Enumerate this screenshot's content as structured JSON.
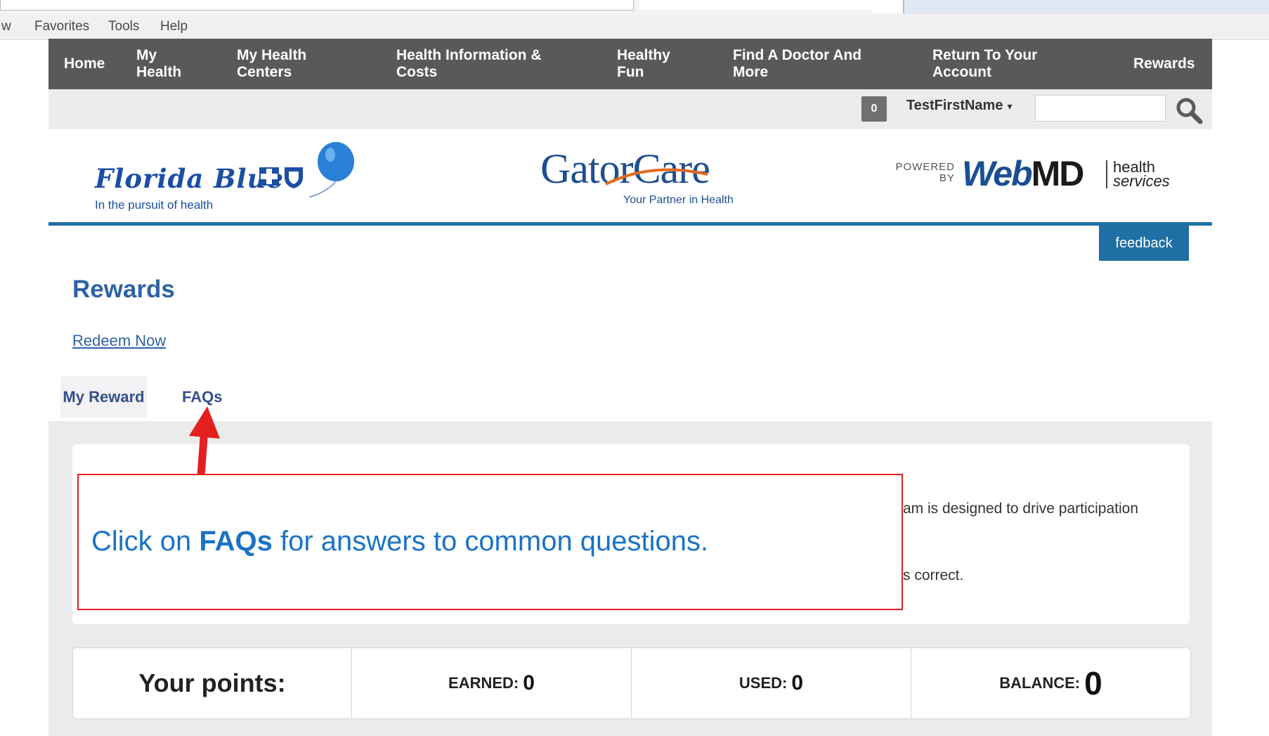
{
  "browser": {
    "menu": [
      "w",
      "Favorites",
      "Tools",
      "Help"
    ]
  },
  "nav": {
    "items": [
      "Home",
      "My Health",
      "My Health Centers",
      "Health Information & Costs",
      "Healthy Fun",
      "Find A Doctor And More",
      "Return To Your Account",
      "Rewards"
    ]
  },
  "utility": {
    "badge_count": "0",
    "username": "TestFirstName",
    "caret": "▾",
    "search_placeholder": ""
  },
  "logos": {
    "florida_blue": "Florida Blue",
    "florida_blue_tagline": "In the pursuit of health",
    "gatorcare": "GatorCare",
    "gatorcare_tagline": "Your Partner in Health",
    "powered_by": "POWERED BY",
    "webmd_web": "Web",
    "webmd_md": "MD",
    "health": "health",
    "services": "services"
  },
  "feedback_label": "feedback",
  "page": {
    "title": "Rewards",
    "redeem_link": "Redeem Now",
    "tabs": [
      "My Reward",
      "FAQs"
    ]
  },
  "info": {
    "line1_fragment": "am is designed to drive participation",
    "line2_fragment": "s correct."
  },
  "points": {
    "heading": "Your points:",
    "earned_label": "EARNED:",
    "earned_value": "0",
    "used_label": "USED:",
    "used_value": "0",
    "balance_label": "BALANCE:",
    "balance_value": "0"
  },
  "callout": {
    "prefix": "Click on ",
    "emphasis": "FAQs",
    "suffix": " for answers to common questions."
  },
  "colors": {
    "nav_bg": "#595959",
    "accent": "#1f6fa5",
    "title_blue": "#2e63a4",
    "callout_border": "#e41f1f",
    "callout_text": "#1b73c5"
  }
}
